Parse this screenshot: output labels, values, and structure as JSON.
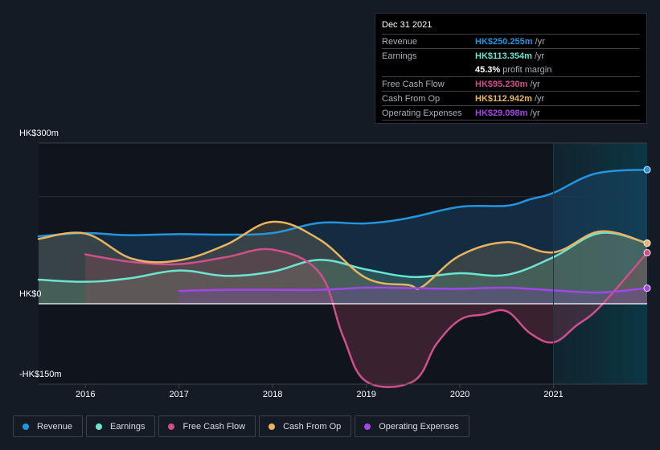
{
  "tooltip": {
    "date": "Dec 31 2021",
    "rows": [
      {
        "label": "Revenue",
        "value": "HK$250.255m",
        "unit": "/yr",
        "color": "#2394df"
      },
      {
        "label": "Earnings",
        "value": "HK$113.354m",
        "unit": "/yr",
        "color": "#6ce5d0"
      },
      {
        "label": "",
        "value": "45.3%",
        "unit": "profit margin",
        "color": "#ffffff"
      },
      {
        "label": "Free Cash Flow",
        "value": "HK$95.230m",
        "unit": "/yr",
        "color": "#cf4f8b"
      },
      {
        "label": "Cash From Op",
        "value": "HK$112.942m",
        "unit": "/yr",
        "color": "#e8b462"
      },
      {
        "label": "Operating Expenses",
        "value": "HK$29.098m",
        "unit": "/yr",
        "color": "#a246e8"
      }
    ]
  },
  "legend": [
    {
      "label": "Revenue",
      "color": "#2394df"
    },
    {
      "label": "Earnings",
      "color": "#6ce5d0"
    },
    {
      "label": "Free Cash Flow",
      "color": "#cf4f8b"
    },
    {
      "label": "Cash From Op",
      "color": "#e8b462"
    },
    {
      "label": "Operating Expenses",
      "color": "#a246e8"
    }
  ],
  "chart_data": {
    "type": "area",
    "title": "",
    "xlabel": "",
    "ylabel": "",
    "currency": "HK$",
    "unit": "m",
    "xlim": [
      2015.5,
      2022.0
    ],
    "ylim": [
      -150,
      300
    ],
    "y_tick_labels": [
      {
        "value": 300,
        "label": "HK$300m"
      },
      {
        "value": 0,
        "label": "HK$0"
      },
      {
        "value": -150,
        "label": "-HK$150m"
      }
    ],
    "x_tick_labels": [
      "2016",
      "2017",
      "2018",
      "2019",
      "2020",
      "2021"
    ],
    "x_ticks": [
      2016,
      2017,
      2018,
      2019,
      2020,
      2021
    ],
    "highlight_range": [
      2021.0,
      2022.0
    ],
    "grid": true,
    "legend_position": "bottom-left",
    "series": [
      {
        "name": "Revenue",
        "color": "#2394df",
        "points": [
          [
            2015.5,
            126
          ],
          [
            2016.0,
            132
          ],
          [
            2016.45,
            128
          ],
          [
            2017.0,
            130
          ],
          [
            2017.5,
            129
          ],
          [
            2018.0,
            132
          ],
          [
            2018.5,
            151
          ],
          [
            2019.0,
            150
          ],
          [
            2019.45,
            160
          ],
          [
            2020.0,
            181
          ],
          [
            2020.5,
            183
          ],
          [
            2020.75,
            195
          ],
          [
            2021.0,
            207
          ],
          [
            2021.45,
            243
          ],
          [
            2022.0,
            250.3
          ]
        ]
      },
      {
        "name": "Earnings",
        "color": "#6ce5d0",
        "points": [
          [
            2015.5,
            45
          ],
          [
            2016.0,
            41
          ],
          [
            2016.45,
            47
          ],
          [
            2017.0,
            62
          ],
          [
            2017.5,
            52
          ],
          [
            2018.0,
            60
          ],
          [
            2018.5,
            82
          ],
          [
            2019.0,
            64
          ],
          [
            2019.5,
            50
          ],
          [
            2020.0,
            57
          ],
          [
            2020.5,
            54
          ],
          [
            2021.0,
            87
          ],
          [
            2021.5,
            132
          ],
          [
            2022.0,
            113.4
          ]
        ]
      },
      {
        "name": "Free Cash Flow",
        "color": "#cf4f8b",
        "points": [
          [
            2016.0,
            92
          ],
          [
            2016.5,
            78
          ],
          [
            2017.0,
            74
          ],
          [
            2017.5,
            87
          ],
          [
            2018.0,
            101
          ],
          [
            2018.5,
            58
          ],
          [
            2018.75,
            -60
          ],
          [
            2019.0,
            -145
          ],
          [
            2019.5,
            -145
          ],
          [
            2019.75,
            -75
          ],
          [
            2020.0,
            -30
          ],
          [
            2020.25,
            -20
          ],
          [
            2020.5,
            -14
          ],
          [
            2020.75,
            -55
          ],
          [
            2021.0,
            -72
          ],
          [
            2021.25,
            -40
          ],
          [
            2021.5,
            -5
          ],
          [
            2022.0,
            95.2
          ]
        ]
      },
      {
        "name": "Cash From Op",
        "color": "#e8b462",
        "points": [
          [
            2015.5,
            121
          ],
          [
            2016.0,
            131
          ],
          [
            2016.5,
            84
          ],
          [
            2017.0,
            81
          ],
          [
            2017.5,
            110
          ],
          [
            2018.0,
            153
          ],
          [
            2018.5,
            120
          ],
          [
            2019.0,
            48
          ],
          [
            2019.45,
            35
          ],
          [
            2019.6,
            32
          ],
          [
            2020.0,
            90
          ],
          [
            2020.5,
            115
          ],
          [
            2021.0,
            96
          ],
          [
            2021.5,
            135
          ],
          [
            2022.0,
            112.9
          ]
        ]
      },
      {
        "name": "Operating Expenses",
        "color": "#a246e8",
        "points": [
          [
            2017.0,
            24
          ],
          [
            2017.5,
            26
          ],
          [
            2018.0,
            26
          ],
          [
            2018.5,
            26
          ],
          [
            2019.0,
            30
          ],
          [
            2019.5,
            29
          ],
          [
            2020.0,
            28
          ],
          [
            2020.5,
            30
          ],
          [
            2021.0,
            25
          ],
          [
            2021.5,
            21
          ],
          [
            2022.0,
            29.1
          ]
        ]
      }
    ]
  }
}
